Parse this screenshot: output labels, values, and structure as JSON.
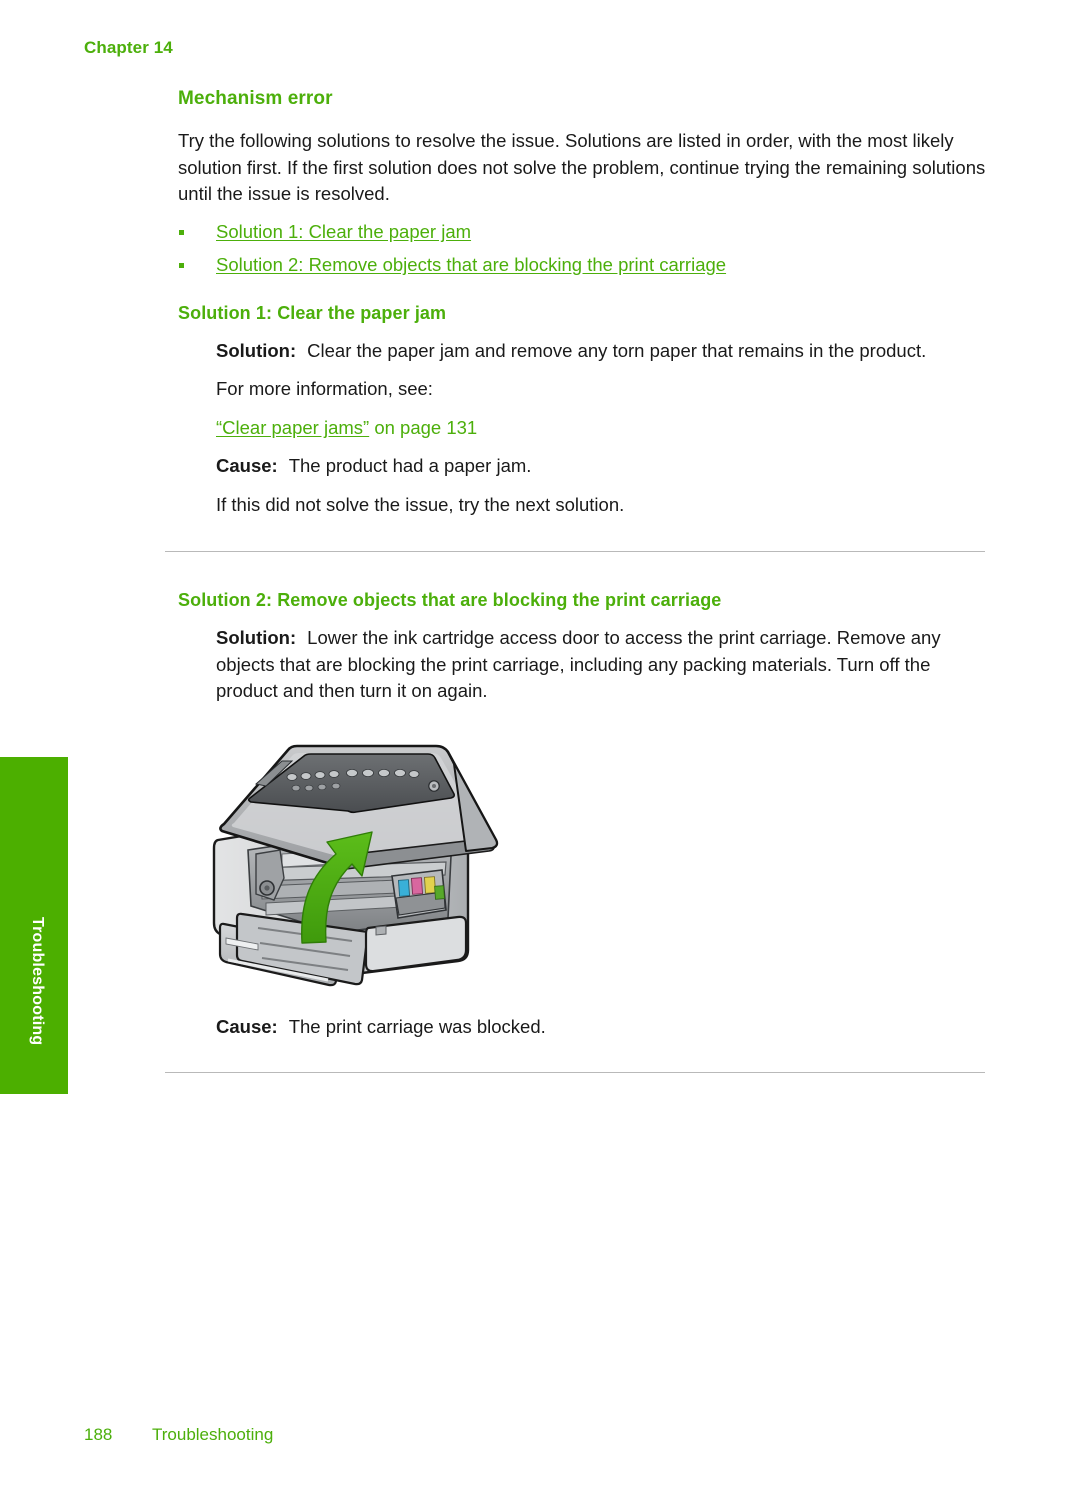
{
  "header": {
    "chapter_label": "Chapter 14"
  },
  "side_tab": {
    "label": "Troubleshooting",
    "color": "#4CAF00"
  },
  "theme": {
    "accent_green": "#4CAF0B",
    "rule_gray": "#b9b9b9",
    "body_text": "#1a1a1a"
  },
  "main": {
    "section_title": "Mechanism error",
    "intro_paragraph": "Try the following solutions to resolve the issue. Solutions are listed in order, with the most likely solution first. If the first solution does not solve the problem, continue trying the remaining solutions until the issue is resolved.",
    "solution_links": [
      {
        "label": "Solution 1: Clear the paper jam"
      },
      {
        "label": "Solution 2: Remove objects that are blocking the print carriage"
      }
    ],
    "solution_1": {
      "heading": "Solution 1: Clear the paper jam",
      "solution_label": "Solution:",
      "solution_text": "Clear the paper jam and remove any torn paper that remains in the product.",
      "more_info_text": "For more information, see:",
      "xref_quoted": "“Clear paper jams”",
      "xref_suffix": " on page 131",
      "cause_label": "Cause:",
      "cause_text": "The product had a paper jam.",
      "next_text": "If this did not solve the issue, try the next solution."
    },
    "solution_2": {
      "heading": "Solution 2: Remove objects that are blocking the print carriage",
      "solution_label": "Solution:",
      "solution_text": "Lower the ink cartridge access door to access the print carriage. Remove any objects that are blocking the print carriage, including any packing materials. Turn off the product and then turn it on again.",
      "cause_label": "Cause:",
      "cause_text": "The print carriage was blocked.",
      "figure": {
        "name": "all-in-one-printer-with-lid-raised",
        "arrow_color": "#4CAF21",
        "description": "All-in-one printer illustration with the scanner lid / ink cartridge access door raised and a green curved arrow indicating the lifting motion"
      }
    }
  },
  "footer": {
    "page_number": "188",
    "section_name": "Troubleshooting"
  }
}
